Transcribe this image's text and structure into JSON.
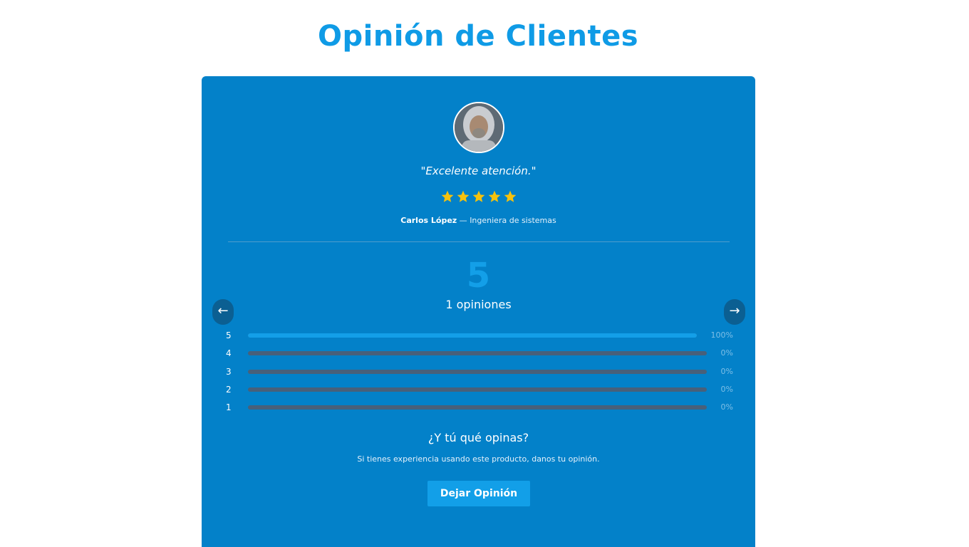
{
  "page": {
    "title": "Opinión de Clientes"
  },
  "colors": {
    "title": "#0f9be6",
    "card_background": "#0381c9",
    "accent": "#139fe8",
    "star": "#f6c20d",
    "bar_track": "#48607a"
  },
  "testimonial": {
    "quote": "\"Excelente atención.\"",
    "rating": 5,
    "max_rating": 5,
    "author_name": "Carlos López",
    "author_separator": " — ",
    "author_role": "Ingeniera de sistemas",
    "avatar_icon": "user-photo"
  },
  "summary": {
    "average": "5",
    "count_label": "1 opiniones"
  },
  "navigation": {
    "prev_icon": "←",
    "next_icon": "→"
  },
  "distribution": [
    {
      "stars": "5",
      "fraction": 1.0,
      "percent_label": "100%"
    },
    {
      "stars": "4",
      "fraction": 0.0,
      "percent_label": "0%"
    },
    {
      "stars": "3",
      "fraction": 0.0,
      "percent_label": "0%"
    },
    {
      "stars": "2",
      "fraction": 0.0,
      "percent_label": "0%"
    },
    {
      "stars": "1",
      "fraction": 0.0,
      "percent_label": "0%"
    }
  ],
  "cta": {
    "title": "¿Y tú qué opinas?",
    "text": "Si tienes experiencia usando este producto, danos tu opinión.",
    "button_label": "Dejar Opinión"
  }
}
